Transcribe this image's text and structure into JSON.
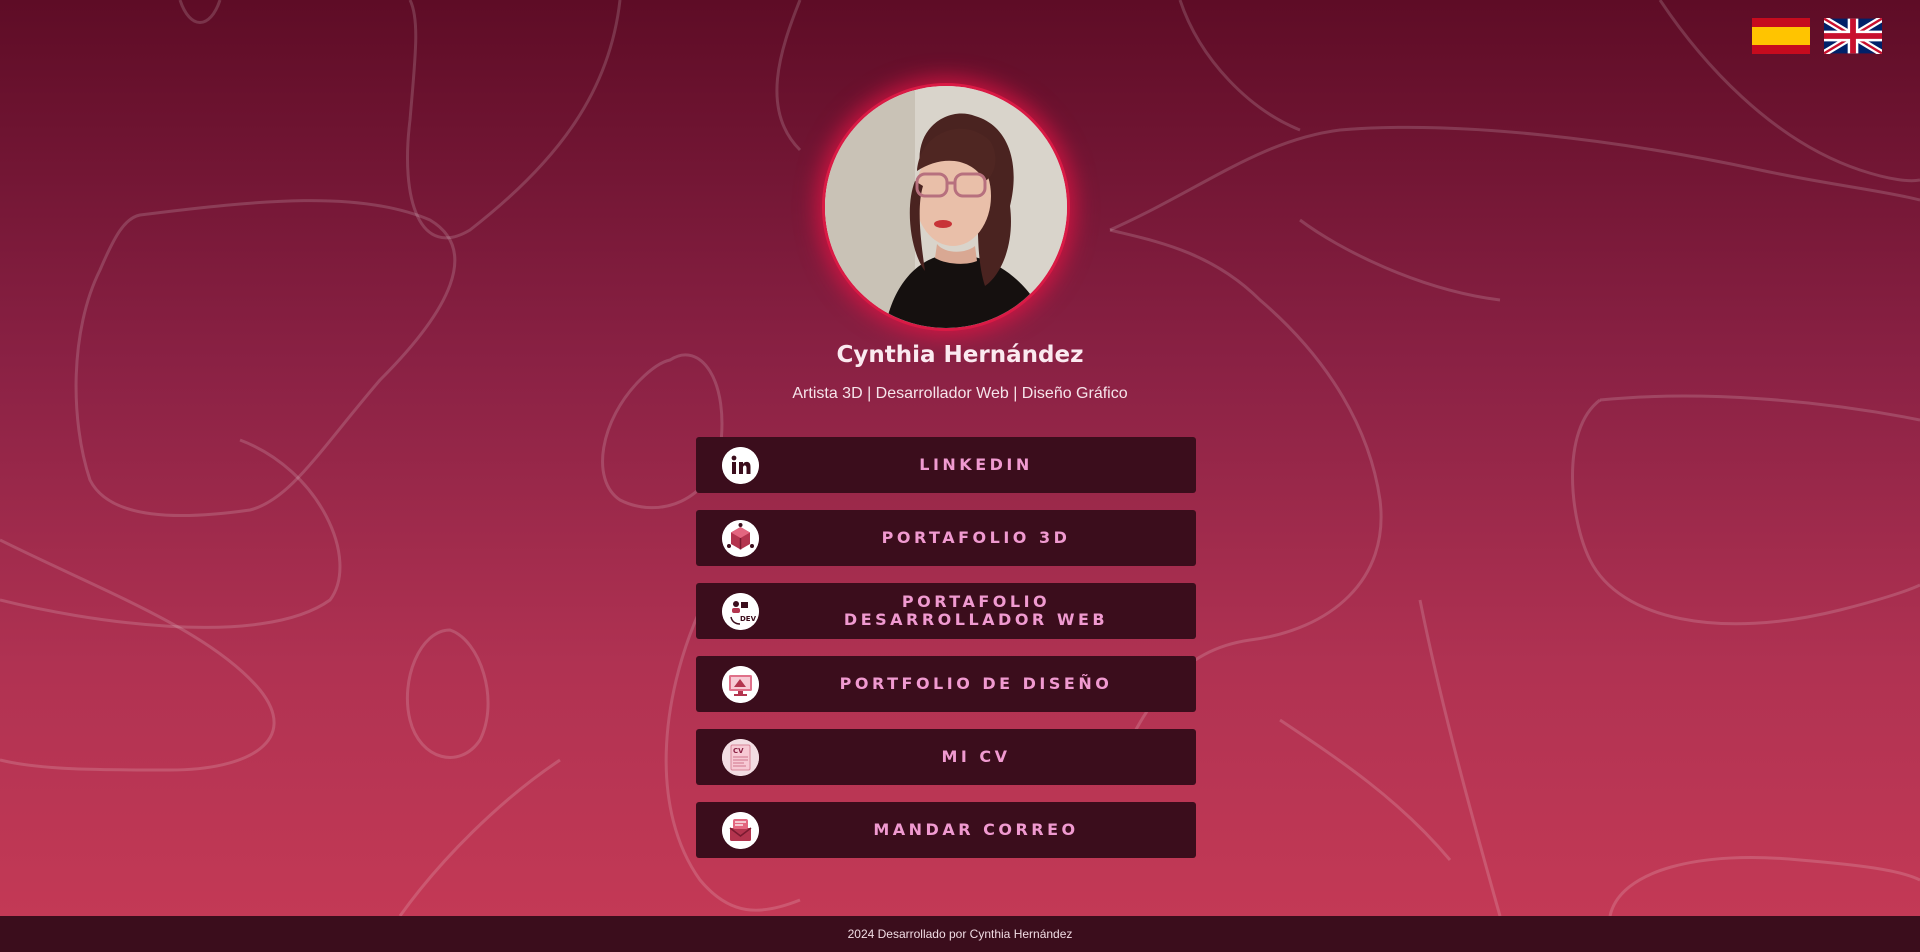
{
  "languages": [
    {
      "name": "Español",
      "icon": "spain-flag-icon"
    },
    {
      "name": "English",
      "icon": "uk-flag-icon"
    }
  ],
  "profile": {
    "name": "Cynthia Hernández",
    "tagline": "Artista 3D | Desarrollador Web | Diseño Gráfico"
  },
  "links": [
    {
      "label": "LINKEDIN",
      "icon": "linkedin-icon"
    },
    {
      "label": "PORTAFOLIO 3D",
      "icon": "cube-3d-icon"
    },
    {
      "label": "PORTAFOLIO DESARROLLADOR WEB",
      "icon": "web-dev-icon"
    },
    {
      "label": "PORTFOLIO DE DISEÑO",
      "icon": "design-monitor-icon"
    },
    {
      "label": "MI CV",
      "icon": "cv-document-icon"
    },
    {
      "label": "MANDAR CORREO",
      "icon": "email-envelope-icon"
    }
  ],
  "footer": {
    "text": "2024 Desarrollado por Cynthia Hernández"
  },
  "colors": {
    "background_top": "#5e0c26",
    "background_bottom": "#c63a56",
    "button_bg": "#3b0d1c",
    "button_text": "#f09ad0",
    "avatar_glow": "#d91a45"
  }
}
